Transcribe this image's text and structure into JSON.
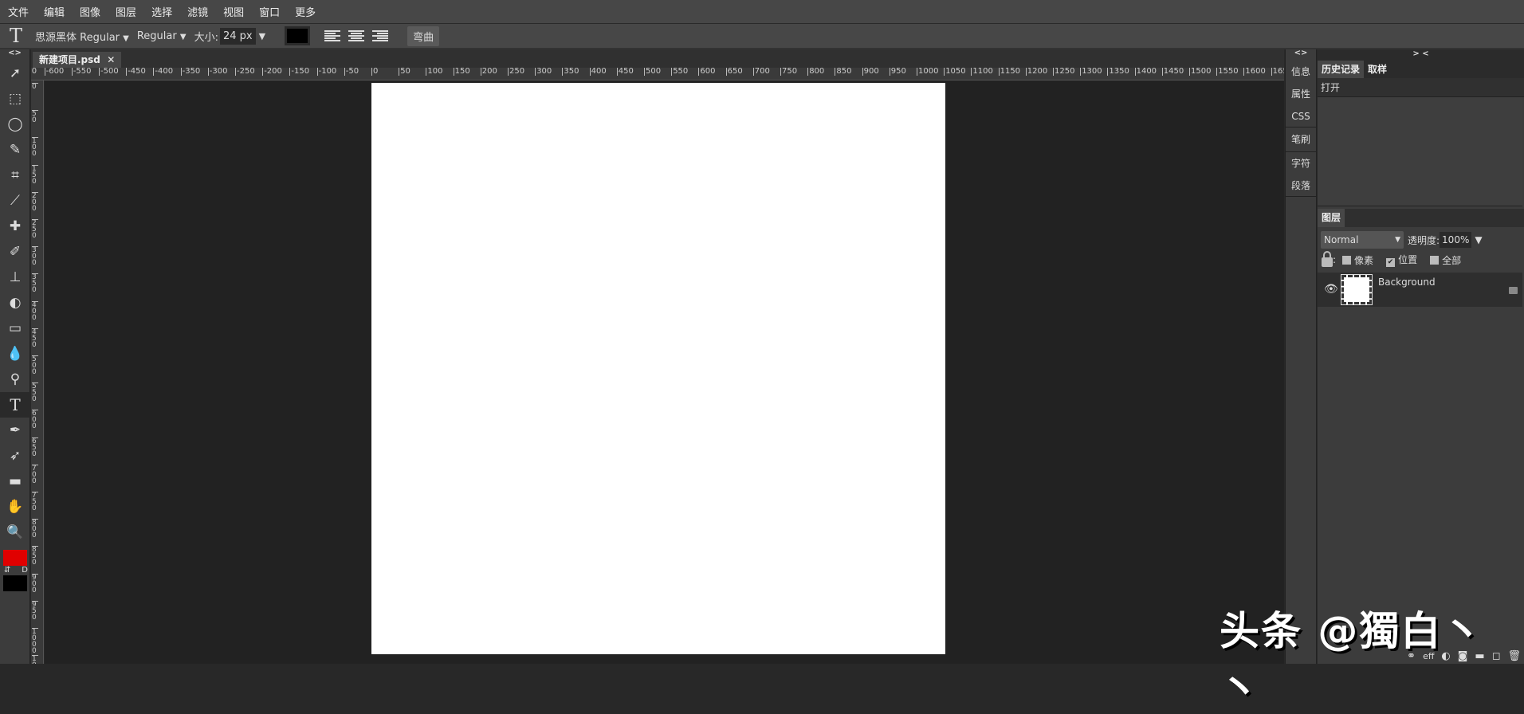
{
  "menu": [
    "文件",
    "编辑",
    "图像",
    "图层",
    "选择",
    "滤镜",
    "视图",
    "窗口",
    "更多"
  ],
  "options": {
    "tool_icon": "type-icon",
    "font_family": "思源黑体 Regular",
    "font_family_arrow": "▼",
    "font_style": "Regular",
    "font_style_arrow": "▼",
    "size_label": "大小:",
    "size_value": "24 px",
    "size_arrow": "▼",
    "text_color": "#000000",
    "warp_label": "弯曲"
  },
  "panel_toggle_left": "<>",
  "document_tab": {
    "name": "新建项目.psd",
    "close": "✕"
  },
  "ruler": {
    "start": -650,
    "end": 1700,
    "step": 50,
    "v_start": 0,
    "v_end": 1050
  },
  "tools": [
    {
      "name": "move-tool",
      "glyph": "➚"
    },
    {
      "name": "marquee-tool",
      "glyph": "⬚"
    },
    {
      "name": "lasso-tool",
      "glyph": "◯"
    },
    {
      "name": "quick-select-tool",
      "glyph": "✎"
    },
    {
      "name": "crop-tool",
      "glyph": "⌗"
    },
    {
      "name": "eyedropper-tool",
      "glyph": "⟋"
    },
    {
      "name": "healing-tool",
      "glyph": "✚"
    },
    {
      "name": "brush-tool",
      "glyph": "✐"
    },
    {
      "name": "stamp-tool",
      "glyph": "⊥"
    },
    {
      "name": "eraser-tool",
      "glyph": "◐"
    },
    {
      "name": "gradient-tool",
      "glyph": "▭"
    },
    {
      "name": "blur-tool",
      "glyph": "💧"
    },
    {
      "name": "dodge-tool",
      "glyph": "⚲"
    },
    {
      "name": "type-tool",
      "glyph": "T"
    },
    {
      "name": "pen-tool",
      "glyph": "✒"
    },
    {
      "name": "path-select-tool",
      "glyph": "➶"
    },
    {
      "name": "shape-tool",
      "glyph": "▬"
    },
    {
      "name": "hand-tool",
      "glyph": "✋"
    },
    {
      "name": "zoom-tool",
      "glyph": "🔍"
    }
  ],
  "colors": {
    "foreground": "#e00000",
    "background": "#000000",
    "swap": "⇵",
    "default": "D"
  },
  "side_icons": [
    "信息",
    "属性",
    "CSS",
    "笔刷",
    "字符",
    "段落"
  ],
  "panel_toggle_right": "> <",
  "history": {
    "tabs": [
      "历史记录",
      "取样"
    ],
    "items": [
      "打开"
    ]
  },
  "layers": {
    "tab": "图层",
    "blend_mode": "Normal",
    "opacity_label": "透明度:",
    "opacity_value": "100%",
    "opacity_arrow": "▼",
    "lock_label": ":",
    "locks": [
      {
        "label": "像素",
        "checked": false
      },
      {
        "label": "位置",
        "checked": true
      },
      {
        "label": "全部",
        "checked": false
      }
    ],
    "items": [
      {
        "name": "Background",
        "visible": true,
        "locked": true
      }
    ],
    "footer": [
      "link-icon",
      "eff",
      "adjustment-icon",
      "mask-icon",
      "folder-icon",
      "new-layer-icon",
      "trash-icon"
    ],
    "footer_eff": "eff"
  },
  "watermark": "头条 @獨白丶丶"
}
